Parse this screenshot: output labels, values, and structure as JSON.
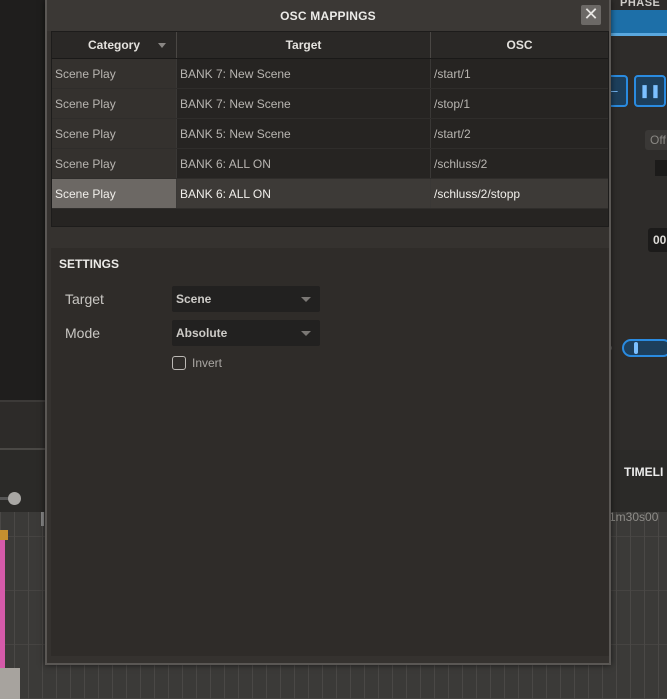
{
  "background": {
    "phase_label": "PHASE",
    "off_label": "Off",
    "time_value": "00",
    "timeline_label": "TIMELI",
    "timecode": "1m30s00",
    "pause_icon": "pause-icon",
    "dash_icon": "minus-icon"
  },
  "dialog": {
    "title": "OSC MAPPINGS",
    "close_icon": "close-icon",
    "close_glyph": "✕"
  },
  "table": {
    "columns": [
      "Category",
      "Target",
      "OSC"
    ],
    "rows": [
      {
        "category": "Scene Play",
        "target": "BANK 7: New Scene",
        "osc": "/start/1"
      },
      {
        "category": "Scene Play",
        "target": "BANK 7: New Scene",
        "osc": "/stop/1"
      },
      {
        "category": "Scene Play",
        "target": "BANK 5: New Scene",
        "osc": "/start/2"
      },
      {
        "category": "Scene Play",
        "target": "BANK 6: ALL ON",
        "osc": "/schluss/2"
      },
      {
        "category": "Scene Play",
        "target": "BANK 6: ALL ON",
        "osc": "/schluss/2/stopp"
      }
    ],
    "selected_row": 4
  },
  "settings": {
    "title": "SETTINGS",
    "target_label": "Target",
    "target_value": "Scene",
    "mode_label": "Mode",
    "mode_value": "Absolute",
    "invert_label": "Invert",
    "invert_checked": false
  },
  "colors": {
    "accent_blue": "#2a8be0",
    "selected_row": "#5f5b57",
    "clip_pink": "#d45aa9"
  }
}
